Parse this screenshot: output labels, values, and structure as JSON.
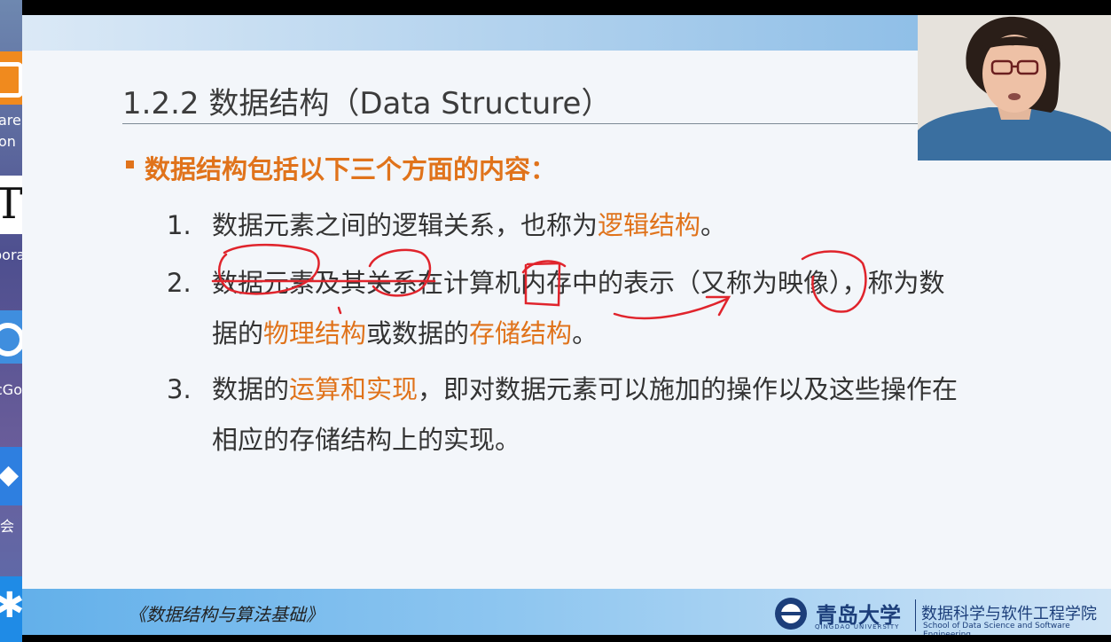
{
  "desktop": {
    "labels": [
      "are",
      "on",
      "bora",
      "cGo",
      "会"
    ]
  },
  "slide": {
    "title": "1.2.2 数据结构（Data Structure）",
    "heading": "数据结构包括以下三个方面的内容：",
    "items": [
      {
        "num": "1.",
        "line1_a": "数据元素之间的逻辑关系，也称为",
        "line1_hl": "逻辑结构",
        "line1_b": "。"
      },
      {
        "num": "2.",
        "line1": "数据元素及其关系在计算机内存中的表示（又称为映像），称为数",
        "line2_a": "据的",
        "line2_hl1": "物理结构",
        "line2_b": "或数据的",
        "line2_hl2": "存储结构",
        "line2_c": "。"
      },
      {
        "num": "3.",
        "line1_a": "数据的",
        "line1_hl": "运算和实现",
        "line1_b": "，即对数据元素可以施加的操作以及这些操作在",
        "line2": "相应的存储结构上的实现。"
      }
    ],
    "footer": {
      "book_title": "《数据结构与算法基础》",
      "university": "青岛大学",
      "university_en": "QINGDAO UNIVERSITY",
      "school": "数据科学与软件工程学院",
      "school_en": "School of Data Science and Software Engineering"
    }
  },
  "colors": {
    "accent": "#e0731b",
    "annotation": "#e0242c",
    "brand": "#1c3e7a"
  }
}
